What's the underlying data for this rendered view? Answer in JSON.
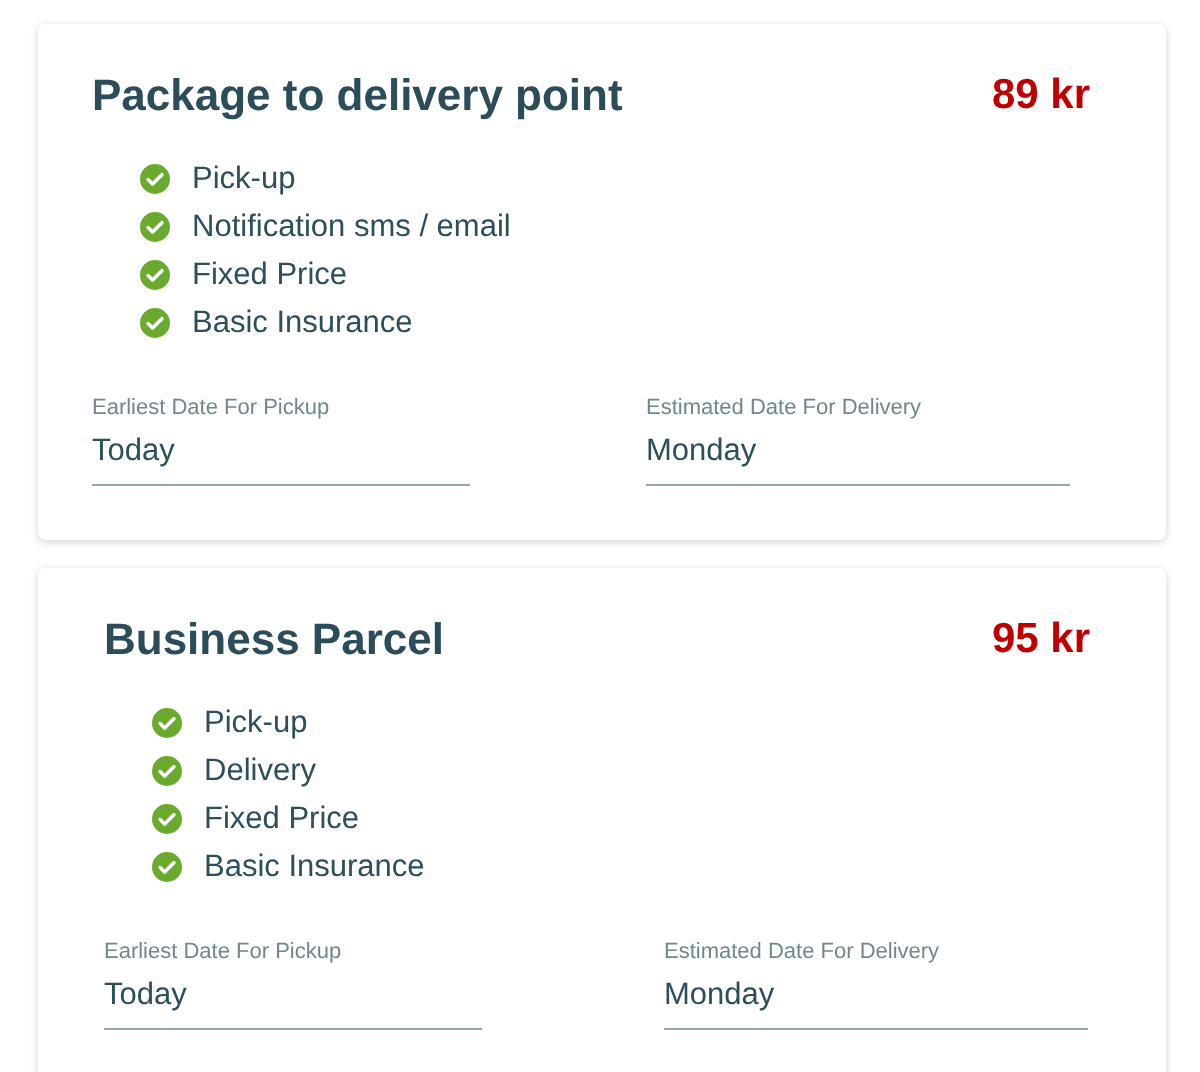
{
  "services": [
    {
      "title": "Package to delivery point",
      "price": "89 kr",
      "features": [
        "Pick-up",
        "Notification sms / email",
        "Fixed Price",
        "Basic Insurance"
      ],
      "fields": [
        {
          "label": "Earliest Date For Pickup",
          "value": "Today"
        },
        {
          "label": "Estimated Date For Delivery",
          "value": "Monday"
        }
      ]
    },
    {
      "title": "Business Parcel",
      "price": "95 kr",
      "features": [
        "Pick-up",
        "Delivery",
        "Fixed Price",
        "Basic Insurance"
      ],
      "fields": [
        {
          "label": "Earliest Date For Pickup",
          "value": "Today"
        },
        {
          "label": "Estimated Date For Delivery",
          "value": "Monday"
        }
      ]
    }
  ]
}
